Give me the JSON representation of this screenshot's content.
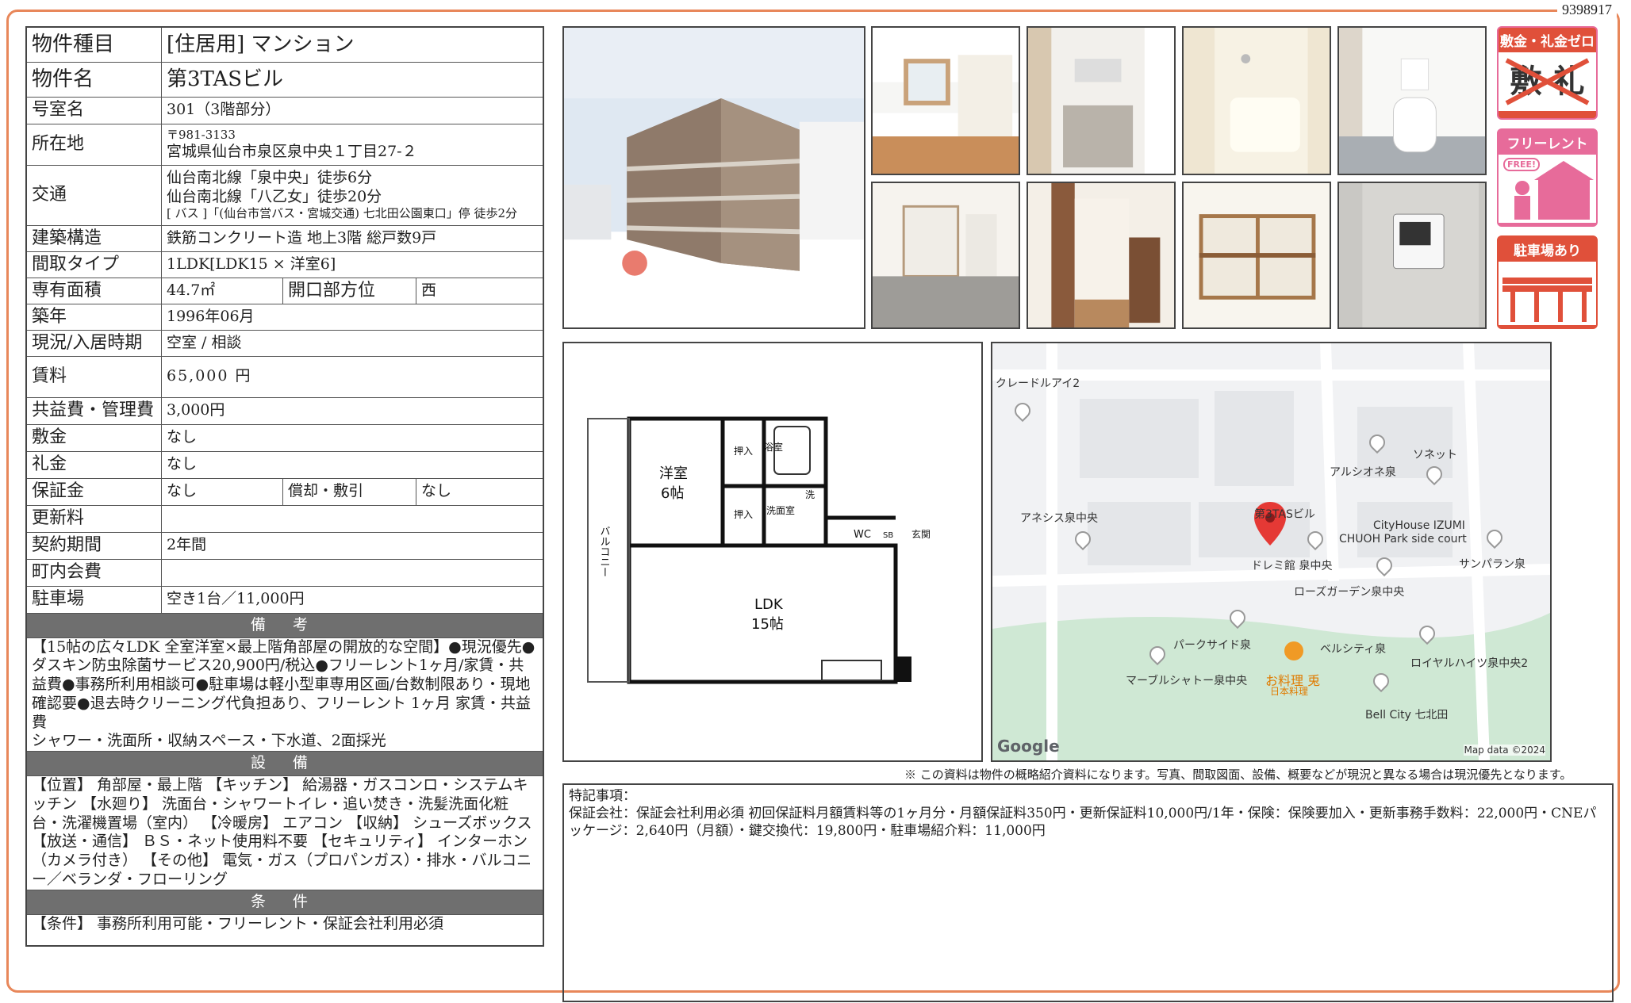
{
  "doc_number": "9398917",
  "table": {
    "type_k": "物件種目",
    "type_v": "[住居用] マンション",
    "name_k": "物件名",
    "name_v": "第3TASビル",
    "room_k": "号室名",
    "room_v": "301（3階部分）",
    "addr_k": "所在地",
    "addr_zip": "〒981-3133",
    "addr_v": "宮城県仙台市泉区泉中央１丁目27-２",
    "traffic_k": "交通",
    "traffic_1": "仙台南北線「泉中央」徒歩6分",
    "traffic_2": "仙台南北線「八乙女」徒歩20分",
    "traffic_3": "[ バス ]「(仙台市営バス・宮城交通) 七北田公園東口」停 徒歩2分",
    "struct_k": "建築構造",
    "struct_v": "鉄筋コンクリート造 地上3階 総戸数9戸",
    "layout_k": "間取タイプ",
    "layout_v": "1LDK[LDK15 × 洋室6]",
    "area_k": "専有面積",
    "area_v": "44.7㎡",
    "dir_k": "開口部方位",
    "dir_v": "西",
    "year_k": "築年",
    "year_v": "1996年06月",
    "status_k": "現況/入居時期",
    "status_v": "空室 / 相談",
    "rent_k": "賃料",
    "rent_v": "65,000 円",
    "fee_k": "共益費・管理費",
    "fee_v": "3,000円",
    "deposit_k": "敷金",
    "deposit_v": "なし",
    "key_k": "礼金",
    "key_v": "なし",
    "guarantee_k": "保証金",
    "guarantee_v": "なし",
    "amort_k": "償却・敷引",
    "amort_v": "なし",
    "renew_k": "更新料",
    "renew_v": "",
    "term_k": "契約期間",
    "term_v": "2年間",
    "town_k": "町内会費",
    "town_v": "",
    "parking_k": "駐車場",
    "parking_v": "空き1台／11,000円"
  },
  "remarks": {
    "title": "備 考",
    "text": "【15帖の広々LDK 全室洋室×最上階角部屋の開放的な空間】●現況優先●ダスキン防虫除菌サービス20,900円/税込●フリーレント1ヶ月/家賃・共益費●事務所利用相談可●駐車場は軽小型車専用区画/台数制限あり・現地確認要●退去時クリーニング代負担あり、フリーレント 1ヶ月 家賃・共益費",
    "text2": "シャワー・洗面所・収納スペース・下水道、2面採光"
  },
  "equipment": {
    "title": "設 備",
    "text": "【位置】 角部屋・最上階 【キッチン】 給湯器・ガスコンロ・システムキッチン 【水廻り】 洗面台・シャワートイレ・追い焚き・洗髪洗面化粧台・洗濯機置場（室内） 【冷暖房】 エアコン 【収納】 シューズボックス 【放送・通信】 ＢＳ・ネット使用料不要 【セキュリティ】 インターホン（カメラ付き） 【その他】 電気・ガス（プロパンガス）・排水・バルコニー／ベランダ・フローリング"
  },
  "conditions": {
    "title": "条 件",
    "text": "【条件】 事務所利用可能・フリーレント・保証会社利用必須"
  },
  "badges": {
    "b1": "敷金・礼金ゼロ",
    "b1_sub": "敷 礼",
    "b2": "フリーレント",
    "b2_sub": "FREE!",
    "b3": "駐車場あり"
  },
  "floorplan": {
    "room1": "洋室",
    "room1_size": "6帖",
    "closet": "押入",
    "bath": "浴室",
    "wash": "洗面室",
    "washer": "洗",
    "wc": "WC",
    "sb": "SB",
    "entry": "玄関",
    "ldk": "LDK",
    "ldk_size": "15帖",
    "balcony": "バルコニー"
  },
  "map": {
    "labels": [
      "クレードルアイ2",
      "アルシオネ泉",
      "ソネット",
      "アネシス泉中央",
      "第3TASビル",
      "CityHouse IZUMI",
      "CHUOH Park side court",
      "ドレミ館 泉中央",
      "サンパラン泉",
      "ローズガーデン泉中央",
      "パークサイド泉",
      "ベルシティ泉",
      "ロイヤルハイツ泉中央2",
      "マーブルシャトー泉中央",
      "お料理 兎",
      "日本料理",
      "Bell City 七北田"
    ],
    "logo": "Google",
    "credit": "Map data ©2024"
  },
  "disclaimer": "※ この資料は物件の概略紹介資料になります。写真、間取図面、設備、概要などが現況と異なる場合は現況優先となります。",
  "special": {
    "title": "特記事項：",
    "text": "保証会社：保証会社利用必須 初回保証料月額賃料等の1ヶ月分・月額保証料350円・更新保証料10,000円/1年・保険：保険要加入・更新事務手数料：22,000円・CNEパッケージ：2,640円（月額）・鍵交換代：19,800円・駐車場紹介料：11,000円"
  },
  "colors": {
    "frame": "#e8875a",
    "section_bg": "#6f6f6f",
    "badge_pink": "#e76b9a",
    "badge_red": "#e0503a"
  }
}
